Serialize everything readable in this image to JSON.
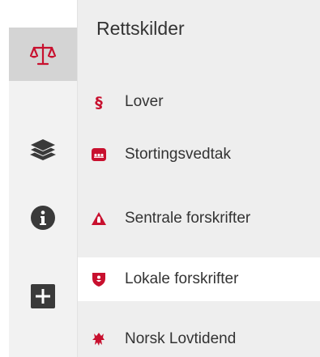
{
  "rail": {
    "items": [
      {
        "icon": "scales-icon",
        "active": true
      },
      {
        "icon": "layers-icon",
        "active": false
      },
      {
        "icon": "info-icon",
        "active": false
      },
      {
        "icon": "plus-icon",
        "active": false
      }
    ]
  },
  "panel": {
    "title": "Rettskilder",
    "items": [
      {
        "label": "Lover",
        "icon": "section-sign-icon",
        "active": false
      },
      {
        "label": "Stortingsvedtak",
        "icon": "stortinget-icon",
        "active": false
      },
      {
        "label": "Sentrale forskrifter",
        "icon": "triangle-emblem-icon",
        "active": false
      },
      {
        "label": "Lokale forskrifter",
        "icon": "shield-emblem-icon",
        "active": true
      },
      {
        "label": "Norsk Lovtidend",
        "icon": "lion-crest-icon",
        "active": false
      }
    ]
  },
  "colors": {
    "accent": "#c8102e",
    "rail_icon": "#3a3a3a",
    "text": "#333333",
    "panel_bg": "#eeeeee",
    "active_bg": "#ffffff",
    "rail_active_bg": "#d4d4d4"
  }
}
